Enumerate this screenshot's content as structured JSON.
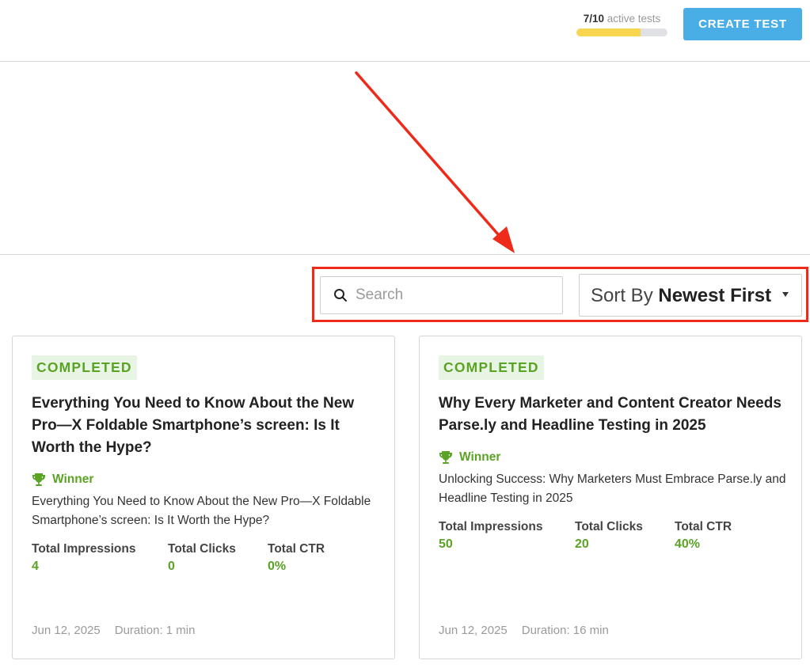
{
  "header": {
    "quota_used": "7/10",
    "quota_suffix": "active tests",
    "quota_fraction": 0.7,
    "create_button": "CREATE TEST"
  },
  "controls": {
    "search_placeholder": "Search",
    "sort_prefix": "Sort By",
    "sort_value": "Newest First"
  },
  "cards": [
    {
      "status": "COMPLETED",
      "title": "Everything You Need to Know About the New Pro—X Foldable Smartphone’s screen: Is It Worth the Hype?",
      "winner_label": "Winner",
      "winner_text": "Everything You Need to Know About the New Pro—X Foldable Smartphone’s screen: Is It Worth the Hype?",
      "stats": [
        {
          "label": "Total Impressions",
          "value": "4"
        },
        {
          "label": "Total Clicks",
          "value": "0"
        },
        {
          "label": "Total CTR",
          "value": "0%"
        }
      ],
      "date": "Jun 12, 2025",
      "duration": "Duration: 1 min"
    },
    {
      "status": "COMPLETED",
      "title": "Why Every Marketer and Content Creator Needs Parse.ly and Headline Testing in 2025",
      "winner_label": "Winner",
      "winner_text": "Unlocking Success: Why Marketers Must Embrace Parse.ly and Headline Testing in 2025",
      "stats": [
        {
          "label": "Total Impressions",
          "value": "50"
        },
        {
          "label": "Total Clicks",
          "value": "20"
        },
        {
          "label": "Total CTR",
          "value": "40%"
        }
      ],
      "date": "Jun 12, 2025",
      "duration": "Duration: 16 min"
    }
  ],
  "colors": {
    "accent_green": "#5aa324",
    "button_blue": "#4aaee6",
    "quota_yellow": "#f7d54e",
    "annotation_red": "#ee2a1b"
  }
}
